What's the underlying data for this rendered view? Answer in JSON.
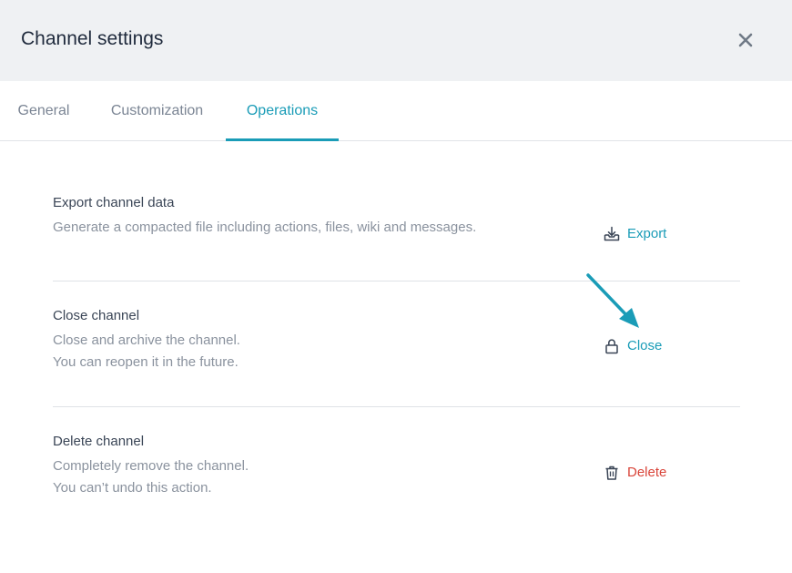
{
  "dialog": {
    "title": "Channel settings",
    "close_icon": "close-x-icon"
  },
  "tabs": [
    {
      "label": "General",
      "active": false
    },
    {
      "label": "Customization",
      "active": false
    },
    {
      "label": "Operations",
      "active": true
    }
  ],
  "sections": [
    {
      "title": "Export channel data",
      "desc": [
        "Generate a compacted file including actions, files, wiki and messages."
      ],
      "action": {
        "label": "Export",
        "icon": "export-tray-icon",
        "color": "#1a9cb7"
      }
    },
    {
      "title": "Close channel",
      "desc": [
        "Close and archive the channel.",
        "You can reopen it in the future."
      ],
      "action": {
        "label": "Close",
        "icon": "lock-icon",
        "color": "#1a9cb7"
      }
    },
    {
      "title": "Delete channel",
      "desc": [
        "Completely remove the channel.",
        "You can’t undo this action."
      ],
      "action": {
        "label": "Delete",
        "icon": "trash-icon",
        "color": "#d9453a"
      }
    }
  ],
  "colors": {
    "accent": "#1a9cb7",
    "danger": "#d9453a",
    "header_bg": "#eff1f3"
  }
}
